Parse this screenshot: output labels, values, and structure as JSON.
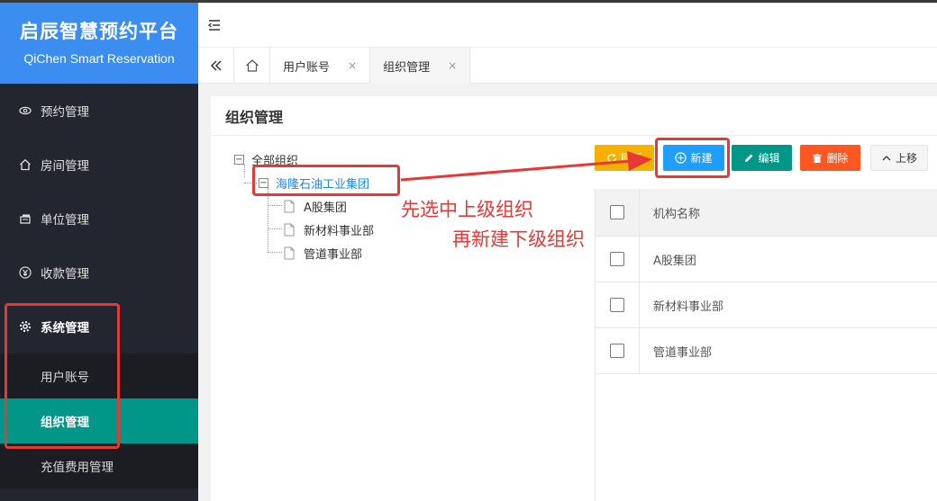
{
  "brand": {
    "title": "启辰智慧预约平台",
    "subtitle": "QiChen Smart Reservation"
  },
  "sidebar": {
    "items": [
      {
        "label": "预约管理",
        "icon": "eye-icon"
      },
      {
        "label": "房间管理",
        "icon": "home-icon"
      },
      {
        "label": "单位管理",
        "icon": "bank-card-icon"
      },
      {
        "label": "收款管理",
        "icon": "yen-icon"
      },
      {
        "label": "系统管理",
        "icon": "gear-icon"
      }
    ],
    "sub_items": [
      {
        "label": "用户账号"
      },
      {
        "label": "组织管理"
      },
      {
        "label": "充值费用管理"
      }
    ]
  },
  "tabs": [
    {
      "label": "用户账号",
      "close": "×"
    },
    {
      "label": "组织管理",
      "close": "×"
    }
  ],
  "panel": {
    "title": "组织管理"
  },
  "tree": {
    "root": "全部组织",
    "selected": "海隆石油工业集团",
    "children": [
      "A股集团",
      "新材料事业部",
      "管道事业部"
    ]
  },
  "toolbar": {
    "refresh_label": "刷新",
    "new_label": "新建",
    "edit_label": "编辑",
    "delete_label": "删除",
    "up_label": "上移"
  },
  "table": {
    "header": "机构名称",
    "rows": [
      "A股集团",
      "新材料事业部",
      "管道事业部"
    ]
  },
  "annotation": {
    "line1": "先选中上级组织",
    "line2": "再新建下级组织"
  },
  "colors": {
    "brand": "#3b8df0",
    "active_menu": "#009688",
    "new_button": "#1e9fff",
    "annotation": "#e53935"
  }
}
